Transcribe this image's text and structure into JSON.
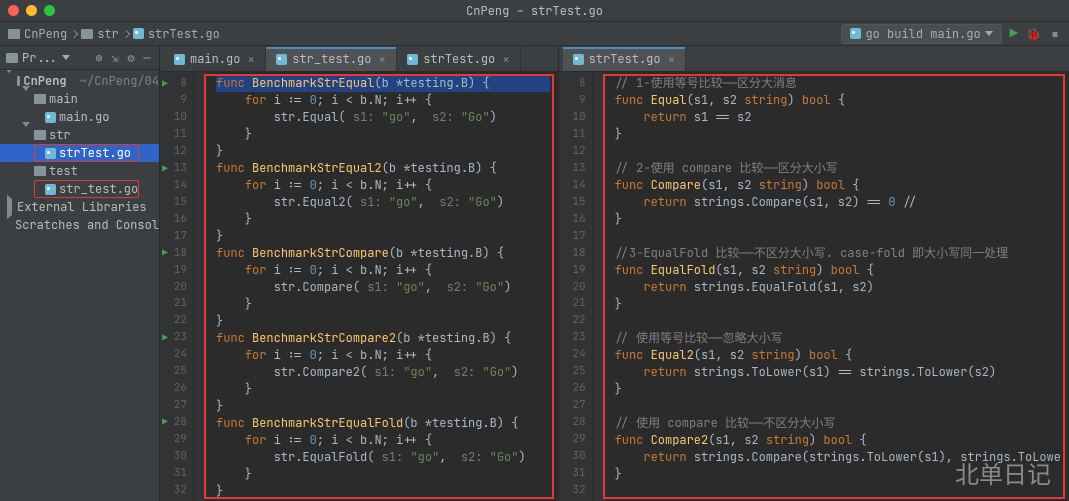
{
  "window": {
    "title": "CnPeng – strTest.go"
  },
  "breadcrumb": {
    "root": "CnPeng",
    "p1": "str",
    "p2": "strTest.go"
  },
  "run_config": "go build main.go",
  "pane": {
    "label": "Pr..."
  },
  "tree": {
    "root": "CnPeng",
    "root_path": "~/CnPeng/04",
    "main_folder": "main",
    "main_file": "main.go",
    "str_folder": "str",
    "str_file": "strTest.go",
    "test_folder": "test",
    "test_file": "str_test.go",
    "ext": "External Libraries",
    "scratch": "Scratches and Consol"
  },
  "tabs_left": {
    "t1": "main.go",
    "t2": "str_test.go",
    "t3": "strTest.go"
  },
  "tabs_right": {
    "t1": "strTest.go"
  },
  "left_ln": [
    "8",
    "9",
    "10",
    "11",
    "12",
    "13",
    "14",
    "15",
    "16",
    "17",
    "18",
    "19",
    "20",
    "21",
    "22",
    "23",
    "24",
    "25",
    "26",
    "27",
    "28",
    "29",
    "30",
    "31",
    "32"
  ],
  "right_ln": [
    "8",
    "9",
    "10",
    "11",
    "12",
    "13",
    "14",
    "15",
    "16",
    "17",
    "18",
    "19",
    "20",
    "21",
    "22",
    "23",
    "24",
    "25",
    "26",
    "27",
    "28",
    "29",
    "30",
    "31",
    "32"
  ],
  "code_left": {
    "l8": {
      "kw": "func ",
      "fn": "BenchmarkStrEqual",
      "rest": "(b *testing.",
      "typ": "B",
      "rest2": ") {"
    },
    "l9": {
      "pre": "    ",
      "kw": "for ",
      "rest": "i := ",
      "n0": "0",
      "rest2": "; i < b.N; i++ {"
    },
    "l10": {
      "pre": "        str.Equal( ",
      "h1": "s1:",
      "s1": " \"go\"",
      "c": ",  ",
      "h2": "s2:",
      "s2": " \"Go\"",
      "end": ")"
    },
    "l11": "    }",
    "l12": "}",
    "l13": {
      "kw": "func ",
      "fn": "BenchmarkStrEqual2",
      "rest": "(b *testing.",
      "typ": "B",
      "rest2": ") {"
    },
    "l14": {
      "pre": "    ",
      "kw": "for ",
      "rest": "i := ",
      "n0": "0",
      "rest2": "; i < b.N; i++ {"
    },
    "l15": {
      "pre": "        str.Equal2( ",
      "h1": "s1:",
      "s1": " \"go\"",
      "c": ",  ",
      "h2": "s2:",
      "s2": " \"Go\"",
      "end": ")"
    },
    "l16": "    }",
    "l17": "}",
    "l18": {
      "kw": "func ",
      "fn": "BenchmarkStrCompare",
      "rest": "(b *testing.",
      "typ": "B",
      "rest2": ") {"
    },
    "l19": {
      "pre": "    ",
      "kw": "for ",
      "rest": "i := ",
      "n0": "0",
      "rest2": "; i < b.N; i++ {"
    },
    "l20": {
      "pre": "        str.Compare( ",
      "h1": "s1:",
      "s1": " \"go\"",
      "c": ",  ",
      "h2": "s2:",
      "s2": " \"Go\"",
      "end": ")"
    },
    "l21": "    }",
    "l22": "}",
    "l23": {
      "kw": "func ",
      "fn": "BenchmarkStrCompare2",
      "rest": "(b *testing.",
      "typ": "B",
      "rest2": ") {"
    },
    "l24": {
      "pre": "    ",
      "kw": "for ",
      "rest": "i := ",
      "n0": "0",
      "rest2": "; i < b.N; i++ {"
    },
    "l25": {
      "pre": "        str.Compare2( ",
      "h1": "s1:",
      "s1": " \"go\"",
      "c": ",  ",
      "h2": "s2:",
      "s2": " \"Go\"",
      "end": ")"
    },
    "l26": "    }",
    "l27": "}",
    "l28": {
      "kw": "func ",
      "fn": "BenchmarkStrEqualFold",
      "rest": "(b *testing.",
      "typ": "B",
      "rest2": ") {"
    },
    "l29": {
      "pre": "    ",
      "kw": "for ",
      "rest": "i := ",
      "n0": "0",
      "rest2": "; i < b.N; i++ {"
    },
    "l30": {
      "pre": "        str.EqualFold( ",
      "h1": "s1:",
      "s1": " \"go\"",
      "c": ",  ",
      "h2": "s2:",
      "s2": " \"Go\"",
      "end": ")"
    },
    "l31": "    }",
    "l32": "}"
  },
  "code_right": {
    "l8": "// 1-使用等号比较——区分大消息",
    "l9": {
      "kw": "func ",
      "fn": "Equal",
      "rest": "(s1, s2 ",
      "typ": "string",
      "rest2": ") ",
      "ret": "bool",
      "rest3": " {"
    },
    "l10": {
      "pre": "    ",
      "kw": "return ",
      "rest": "s1 == s2"
    },
    "l11": "}",
    "l12": "",
    "l13": "// 2-使用 compare 比较——区分大小写",
    "l14": {
      "kw": "func ",
      "fn": "Compare",
      "rest": "(s1, s2 ",
      "typ": "string",
      "rest2": ") ",
      "ret": "bool",
      "rest3": " {"
    },
    "l15": {
      "pre": "    ",
      "kw": "return ",
      "rest": "strings.Compare(s1, s2) == ",
      "n": "0",
      "rest2": " //"
    },
    "l16": "}",
    "l17": "",
    "l18": "//3-EqualFold 比较——不区分大小写. case-fold 即大小写同一处理",
    "l19": {
      "kw": "func ",
      "fn": "EqualFold",
      "rest": "(s1, s2 ",
      "typ": "string",
      "rest2": ") ",
      "ret": "bool",
      "rest3": " {"
    },
    "l20": {
      "pre": "    ",
      "kw": "return ",
      "rest": "strings.EqualFold(s1, s2)"
    },
    "l21": "}",
    "l22": "",
    "l23": "// 使用等号比较——忽略大小写",
    "l24": {
      "kw": "func ",
      "fn": "Equal2",
      "rest": "(s1, s2 ",
      "typ": "string",
      "rest2": ") ",
      "ret": "bool",
      "rest3": " {"
    },
    "l25": {
      "pre": "    ",
      "kw": "return ",
      "rest": "strings.ToLower(s1) == strings.ToLower(s2)"
    },
    "l26": "}",
    "l27": "",
    "l28": "// 使用 compare 比较——不区分大小写",
    "l29": {
      "kw": "func ",
      "fn": "Compare2",
      "rest": "(s1, s2 ",
      "typ": "string",
      "rest2": ") ",
      "ret": "bool",
      "rest3": " {"
    },
    "l30": {
      "pre": "    ",
      "kw": "return ",
      "rest": "strings.Compare(strings.ToLower(s1), strings.ToLowe"
    },
    "l31": "}",
    "l32": ""
  },
  "watermark": "北单日记"
}
